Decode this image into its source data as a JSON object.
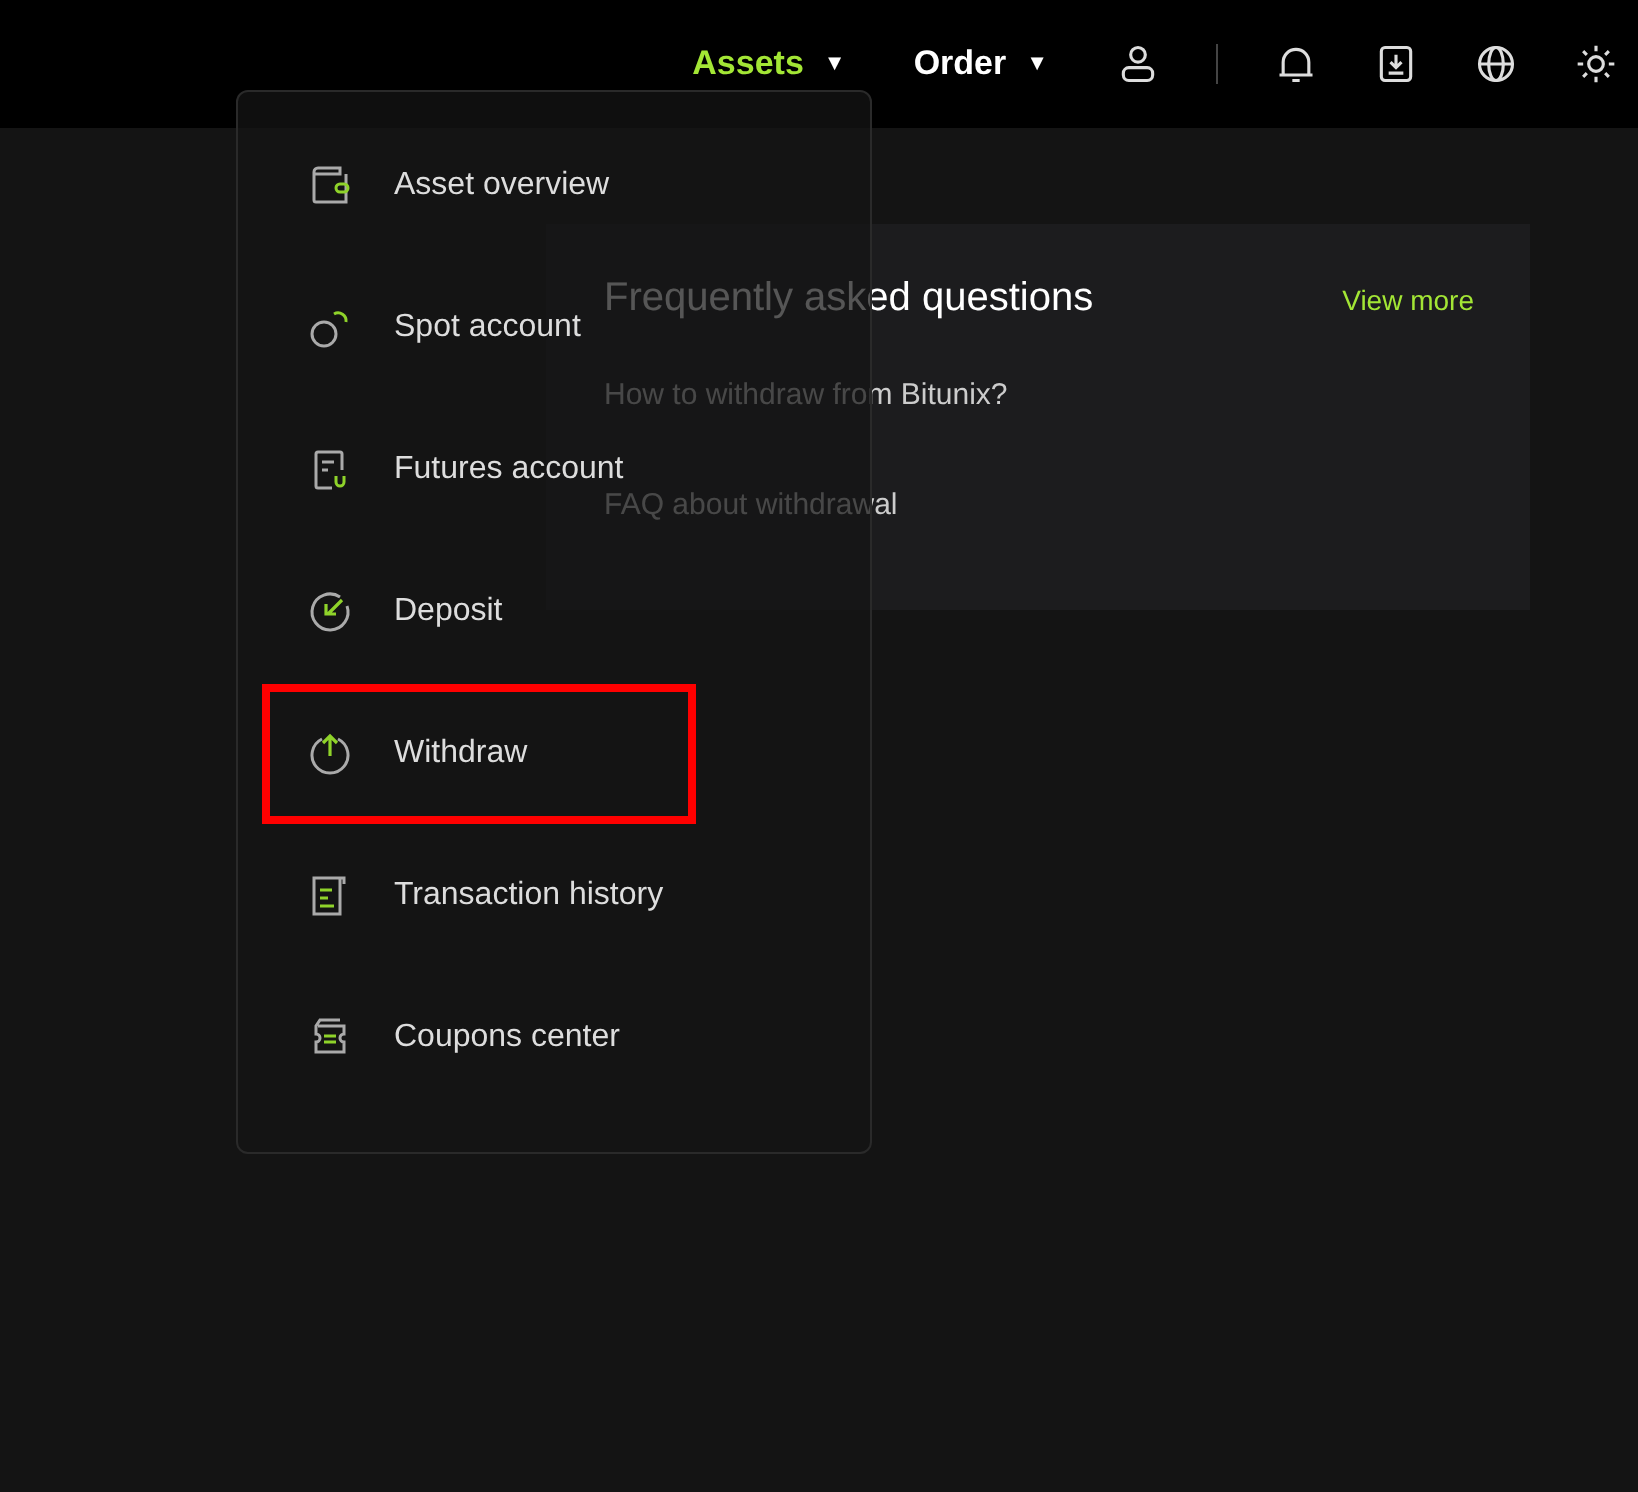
{
  "nav": {
    "items": [
      {
        "label": "Assets",
        "caret": "▼",
        "selected": true
      },
      {
        "label": "Order",
        "caret": "▼",
        "selected": false
      }
    ]
  },
  "assets_menu": {
    "items": [
      {
        "kind": "wallet",
        "label": "Asset overview",
        "highlighted": false
      },
      {
        "kind": "spot",
        "label": "Spot account",
        "highlighted": false
      },
      {
        "kind": "futures",
        "label": "Futures account",
        "highlighted": false
      },
      {
        "kind": "deposit",
        "label": "Deposit",
        "highlighted": false
      },
      {
        "kind": "withdraw",
        "label": "Withdraw",
        "highlighted": true
      },
      {
        "kind": "history",
        "label": "Transaction history",
        "highlighted": false
      },
      {
        "kind": "coupon",
        "label": "Coupons center",
        "highlighted": false
      }
    ]
  },
  "faq": {
    "title": "Frequently asked questions",
    "view_more": "View more",
    "questions": [
      "How to withdraw from Bitunix?",
      "FAQ about withdrawal"
    ]
  }
}
